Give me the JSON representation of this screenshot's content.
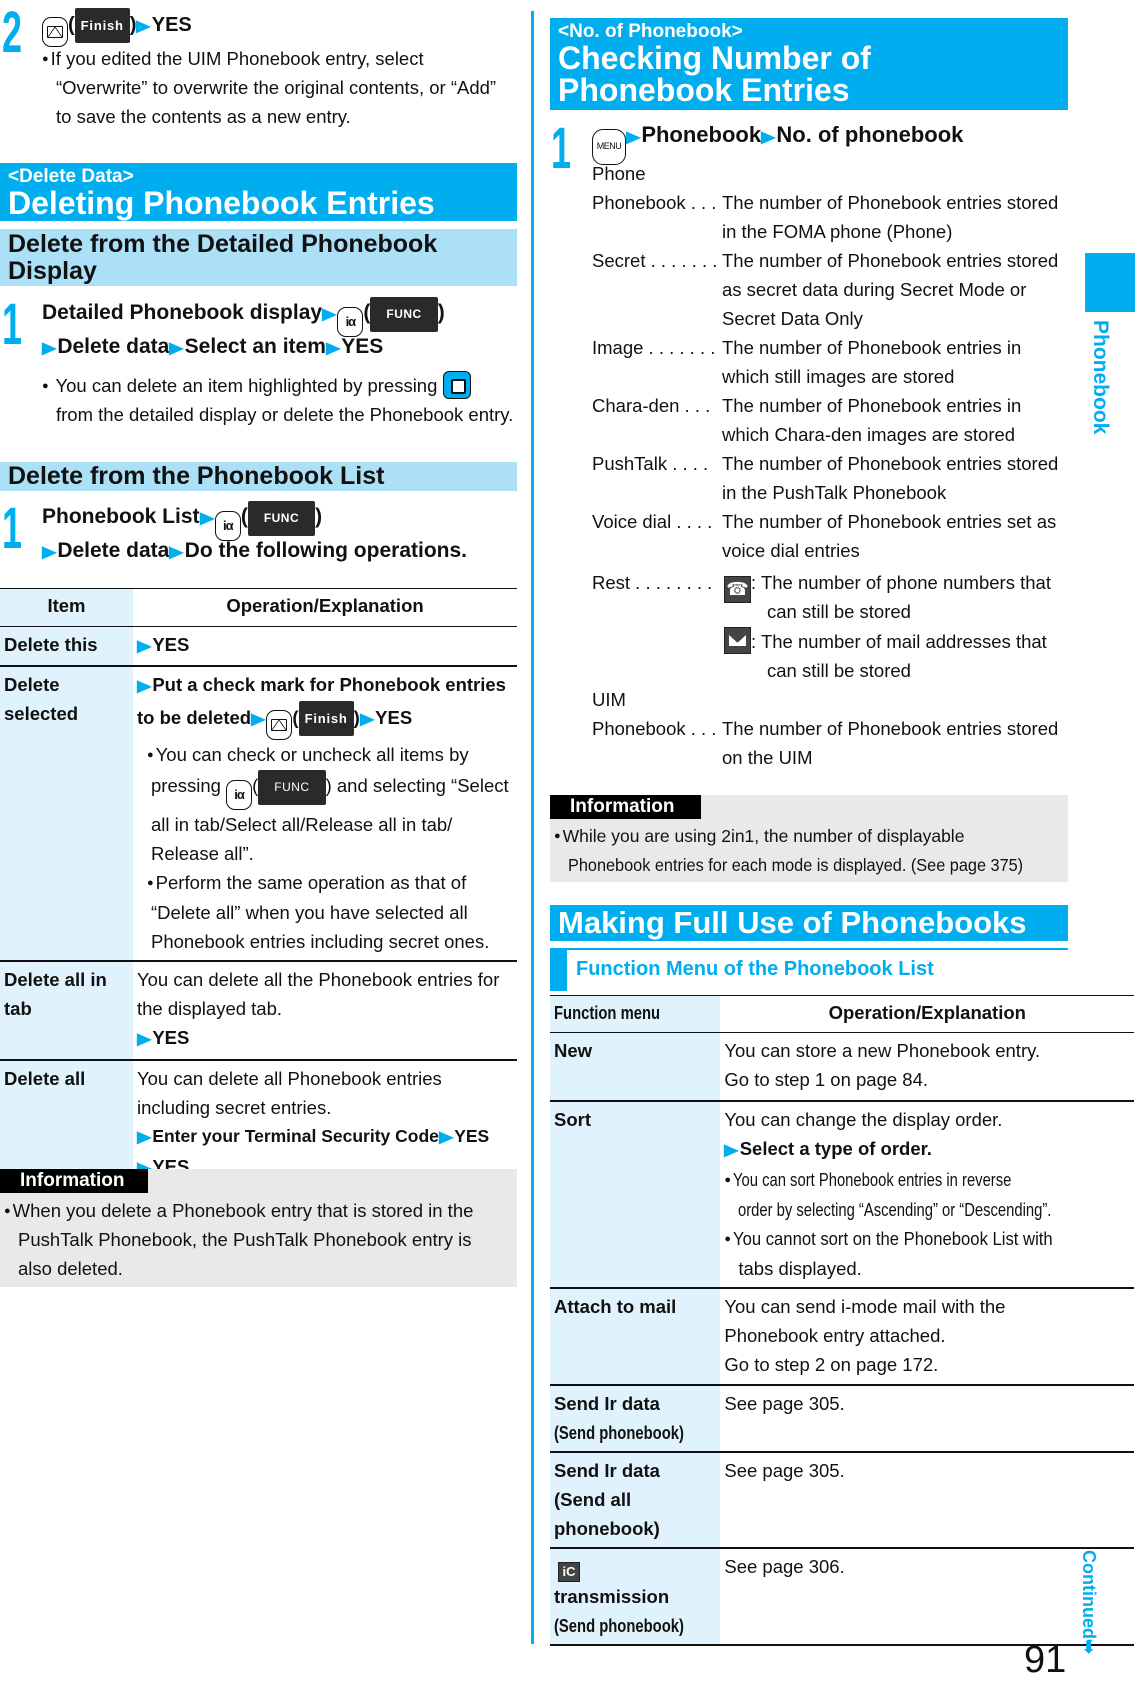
{
  "colors": {
    "accent": "#00aeef",
    "subband": "#abe0f6",
    "key_column": "#e0f3fc",
    "info_bg": "#e9e9e9"
  },
  "left": {
    "step2": {
      "number": "2",
      "soft_key": "Finish",
      "action": "YES",
      "note_lines": [
        "If you edited the UIM Phonebook entry, select",
        "“Overwrite” to overwrite the original contents, or “Add”",
        "to save the contents as a new entry."
      ]
    },
    "delete_section": {
      "tag": "<Delete Data>",
      "title": "Deleting Phonebook Entries"
    },
    "detailed": {
      "subtitle_lines": [
        "Delete from the Detailed Phonebook",
        "Display"
      ],
      "step_number": "1",
      "line1_text": "Detailed Phonebook display",
      "soft_key": "FUNC",
      "line2_parts": [
        "Delete data",
        "Select an item",
        "YES"
      ],
      "note_line1": "You can delete an item highlighted by pressing",
      "note_line2": "from the detailed display or delete the Phonebook entry."
    },
    "list": {
      "subtitle": "Delete from the Phonebook List",
      "step_number": "1",
      "line1_text": "Phonebook List",
      "soft_key": "FUNC",
      "line2_parts": [
        "Delete data",
        "Do the following operations."
      ]
    },
    "table": {
      "headers": [
        "Item",
        "Operation/Explanation"
      ],
      "rows": {
        "delete_this": {
          "item": "Delete this",
          "op": "YES"
        },
        "delete_selected": {
          "item_lines": [
            "Delete",
            "selected"
          ],
          "op_line1": "Put a check mark for Phonebook entries",
          "op_line2a": "to be deleted",
          "soft_key": "Finish",
          "op_line2b": "YES",
          "b1_line1": "You can check or uncheck all items by",
          "b1_pressing": "pressing",
          "b1_soft_key": "FUNC",
          "b1_after": ") and selecting “Select",
          "b1_line3": "all in tab/Select all/Release all in tab/",
          "b1_line4": "Release all”.",
          "b2_lines": [
            "Perform the same operation as that of",
            "“Delete all” when you have selected all",
            "Phonebook entries including secret ones."
          ]
        },
        "delete_all_in_tab": {
          "item_lines": [
            "Delete all in",
            "tab"
          ],
          "op_lines": [
            "You can delete all the Phonebook entries for",
            "the displayed tab."
          ],
          "op_action": "YES"
        },
        "delete_all": {
          "item": "Delete all",
          "op_lines": [
            "You can delete all Phonebook entries",
            "including secret entries."
          ],
          "op_action1": "Enter your Terminal Security Code",
          "op_action2": "YES",
          "op_action3": "YES"
        }
      }
    },
    "info": {
      "label": "Information",
      "lines": [
        "When you delete a Phonebook entry that is stored in the",
        "PushTalk Phonebook, the PushTalk Phonebook entry is",
        "also deleted."
      ]
    }
  },
  "right": {
    "number_section": {
      "tag": "<No. of Phonebook>",
      "title_lines": [
        "Checking Number of",
        "Phonebook Entries"
      ]
    },
    "step1": {
      "number": "1",
      "menu_key": "MENU",
      "parts": [
        "Phonebook",
        "No. of phonebook"
      ]
    },
    "phone_group": "Phone",
    "entries": [
      {
        "key": "Phonebook . . .",
        "lines": [
          "The number of Phonebook entries stored",
          "in the FOMA phone (Phone)"
        ]
      },
      {
        "key": "Secret . . . . . . .",
        "lines": [
          "The number of Phonebook entries stored",
          "as secret data during Secret Mode or",
          "Secret Data Only"
        ]
      },
      {
        "key": "Image . . . . . . .",
        "lines": [
          "The number of Phonebook entries in",
          "which still images are stored"
        ]
      },
      {
        "key": "Chara-den  . . .",
        "lines": [
          "The number of Phonebook entries in",
          "which Chara-den images are stored"
        ]
      },
      {
        "key": "PushTalk  . . . .",
        "lines": [
          "The number of Phonebook entries stored",
          "in the PushTalk Phonebook"
        ]
      },
      {
        "key": "Voice dial  . . . .",
        "lines": [
          "The number of Phonebook entries set as",
          "voice dial entries"
        ]
      }
    ],
    "rest": {
      "key": "Rest  . . . . . . . .",
      "phone_lines": [
        ": The number of phone numbers that",
        "can still be stored"
      ],
      "mail_lines": [
        ": The number of mail addresses that",
        "can still be stored"
      ]
    },
    "uim_group": "UIM",
    "uim_entry": {
      "key": "Phonebook . . .",
      "lines": [
        "The number of Phonebook entries stored",
        "on the UIM"
      ]
    },
    "info": {
      "label": "Information",
      "lines": [
        "While you are using 2in1, the number of displayable",
        "Phonebook entries for each mode is displayed. (See page 375)"
      ]
    },
    "making": {
      "title": "Making Full Use of Phonebooks"
    },
    "function_menu": {
      "subtitle": "Function Menu of the Phonebook List",
      "headers": [
        "Function menu",
        "Operation/Explanation"
      ],
      "rows": {
        "new": {
          "item": "New",
          "op_lines": [
            "You can store a new Phonebook entry.",
            "Go to step 1 on page 84."
          ]
        },
        "sort": {
          "item": "Sort",
          "op_line1": "You can change the display order.",
          "op_action": "Select a type of order.",
          "b1_lines": [
            "You can sort Phonebook entries in reverse",
            "order by selecting “Ascending” or “Descending”."
          ],
          "b2_lines": [
            "You cannot sort on the Phonebook List with",
            "tabs displayed."
          ]
        },
        "attach": {
          "item": "Attach to mail",
          "op_lines": [
            "You can send i-mode mail with the",
            "Phonebook entry attached.",
            "Go to step 2 on page 172."
          ]
        },
        "ir_one": {
          "item_line1": "Send Ir data",
          "item_line2": "(Send phonebook)",
          "op": "See page 305."
        },
        "ir_all": {
          "item_lines": [
            "Send Ir data",
            "(Send all",
            "phonebook)"
          ],
          "op": "See page 305."
        },
        "ic": {
          "item_line1": "transmission",
          "item_line2": "(Send phonebook)",
          "op": "See page 306."
        }
      }
    }
  },
  "side_tab": {
    "label": "Phonebook",
    "continued": "Continued"
  },
  "page_number": "91"
}
